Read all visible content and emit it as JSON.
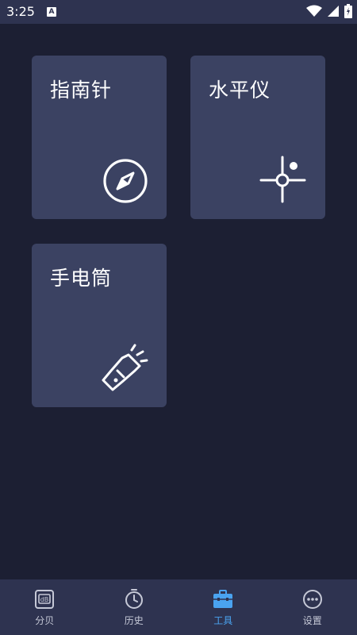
{
  "status_bar": {
    "time": "3:25",
    "notification_letter": "A"
  },
  "tools": [
    {
      "title": "指南针",
      "icon": "compass-icon"
    },
    {
      "title": "水平仪",
      "icon": "crosshair-level-icon"
    },
    {
      "title": "手电筒",
      "icon": "flashlight-icon"
    }
  ],
  "bottom_nav": {
    "items": [
      {
        "label": "分贝",
        "icon": "decibel-icon",
        "active": false
      },
      {
        "label": "历史",
        "icon": "history-clock-icon",
        "active": false
      },
      {
        "label": "工具",
        "icon": "toolbox-icon",
        "active": true
      },
      {
        "label": "设置",
        "icon": "settings-more-icon",
        "active": false
      }
    ]
  },
  "colors": {
    "background": "#1c1f33",
    "card": "#3b4262",
    "bars": "#2e3350",
    "active": "#4aa3f0"
  }
}
